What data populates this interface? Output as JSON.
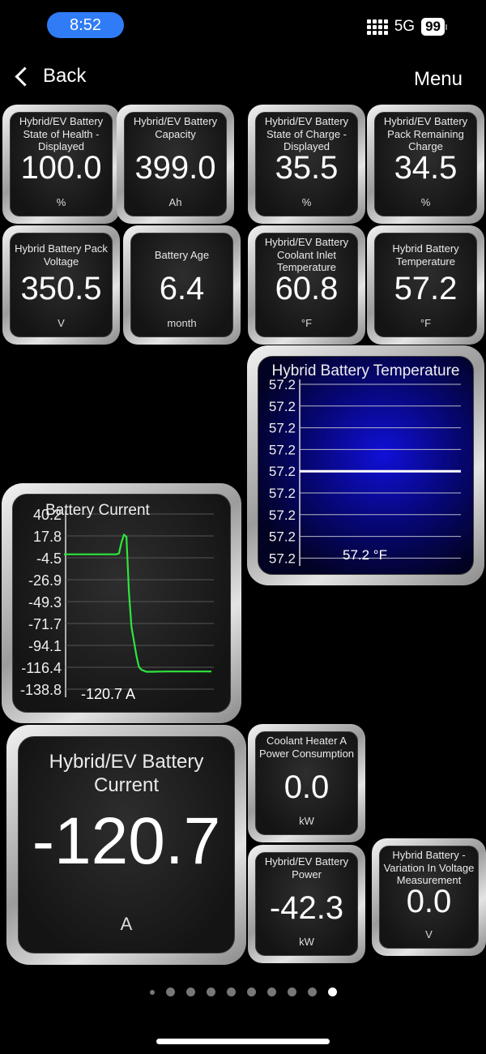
{
  "status_bar": {
    "time": "8:52",
    "network": "5G",
    "battery": "99"
  },
  "nav": {
    "back_label": "Back",
    "menu_label": "Menu"
  },
  "gauges": {
    "soh": {
      "title": "Hybrid/EV Battery State of Health - Displayed",
      "value": "100.0",
      "unit": "%"
    },
    "cap": {
      "title": "Hybrid/EV Battery Capacity",
      "value": "399.0",
      "unit": "Ah"
    },
    "soc": {
      "title": "Hybrid/EV Battery State of Charge - Displayed",
      "value": "35.5",
      "unit": "%"
    },
    "rem": {
      "title": "Hybrid/EV Battery Pack Remaining Charge",
      "value": "34.5",
      "unit": "%"
    },
    "volt": {
      "title": "Hybrid Battery Pack Voltage",
      "value": "350.5",
      "unit": "V"
    },
    "age": {
      "title": "Battery Age",
      "value": "6.4",
      "unit": "month"
    },
    "cool": {
      "title": "Hybrid/EV Battery Coolant Inlet Temperature",
      "value": "60.8",
      "unit": "°F"
    },
    "temp": {
      "title": "Hybrid Battery Temperature",
      "value": "57.2",
      "unit": "°F"
    },
    "current": {
      "title": "Hybrid/EV Battery Current",
      "value": "-120.7",
      "unit": "A"
    },
    "heater": {
      "title": "Coolant Heater A Power Consumption",
      "value": "0.0",
      "unit": "kW"
    },
    "power": {
      "title": "Hybrid/EV Battery Power",
      "value": "-42.3",
      "unit": "kW"
    },
    "vvar": {
      "title": "Hybrid Battery - Variation In Voltage Measurement",
      "value": "0.0",
      "unit": "V"
    }
  },
  "temp_bar_chart": {
    "title": "Hybrid Battery Temperature",
    "ticks": [
      "57.2",
      "57.2",
      "57.2",
      "57.2",
      "57.2",
      "57.2",
      "57.2",
      "57.2",
      "57.2"
    ],
    "readout": "57.2 °F"
  },
  "current_chart": {
    "title": "Battery Current",
    "ticks": [
      "40.2",
      "17.8",
      "-4.5",
      "-26.9",
      "-49.3",
      "-71.7",
      "-94.1",
      "-116.4",
      "-138.8"
    ],
    "readout": "-120.7 A"
  },
  "chart_data": [
    {
      "type": "line",
      "title": "Battery Current",
      "ylim": [
        -138.8,
        40.2
      ],
      "yticks": [
        40.2,
        17.8,
        -4.5,
        -26.9,
        -49.3,
        -71.7,
        -94.1,
        -116.4,
        -138.8
      ],
      "series": [
        {
          "color": "#2ee63c",
          "values": [
            -1,
            -1,
            -1,
            -1,
            -1,
            -1,
            -1,
            -1,
            -1,
            -1,
            -1,
            -1,
            -1,
            -1,
            -1,
            -1,
            -1,
            -1,
            -1,
            -1,
            -1,
            -1,
            0,
            11,
            19,
            17,
            -40,
            -75,
            -90,
            -105,
            -116,
            -119,
            -120,
            -121,
            -121,
            -121,
            -121,
            -120.9,
            -120.8,
            -120.8,
            -120.8,
            -120.7,
            -120.7,
            -120.7,
            -120.7,
            -120.7,
            -120.7,
            -120.7,
            -120.7,
            -120.7,
            -120.7,
            -120.7,
            -120.7,
            -120.7,
            -120.7,
            -120.7,
            -120.7,
            -120.7,
            -120.7,
            -120.7
          ]
        }
      ]
    },
    {
      "type": "line",
      "title": "Hybrid Battery Temperature",
      "ylim": [
        57.2,
        57.2
      ],
      "series": [
        {
          "color": "#ffffff",
          "values": [
            57.2
          ]
        }
      ]
    }
  ],
  "page_dots": {
    "count": 10,
    "active": 9
  }
}
